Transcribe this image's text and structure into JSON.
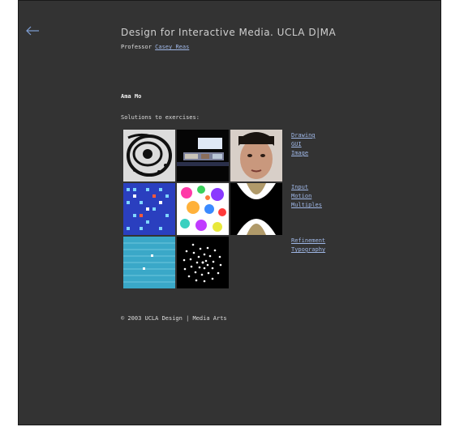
{
  "header": {
    "title": "Design for Interactive Media. UCLA D|MA",
    "professor_prefix": "Professor",
    "professor_name": "Casey Reas"
  },
  "student": {
    "name": "Ama Mo"
  },
  "section": {
    "heading": "Solutions to exercises:"
  },
  "links": {
    "group1": [
      "Drawing",
      "GUI",
      "Image"
    ],
    "group2": [
      "Input",
      "Motion",
      "Multiples"
    ],
    "group3": [
      "Refinement",
      "Typography"
    ]
  },
  "footer": {
    "text": "© 2003 UCLA Design | Media Arts"
  },
  "colors": {
    "background": "#333333",
    "link": "#9fb7e6",
    "accent_arrow": "#7f9fd6"
  }
}
